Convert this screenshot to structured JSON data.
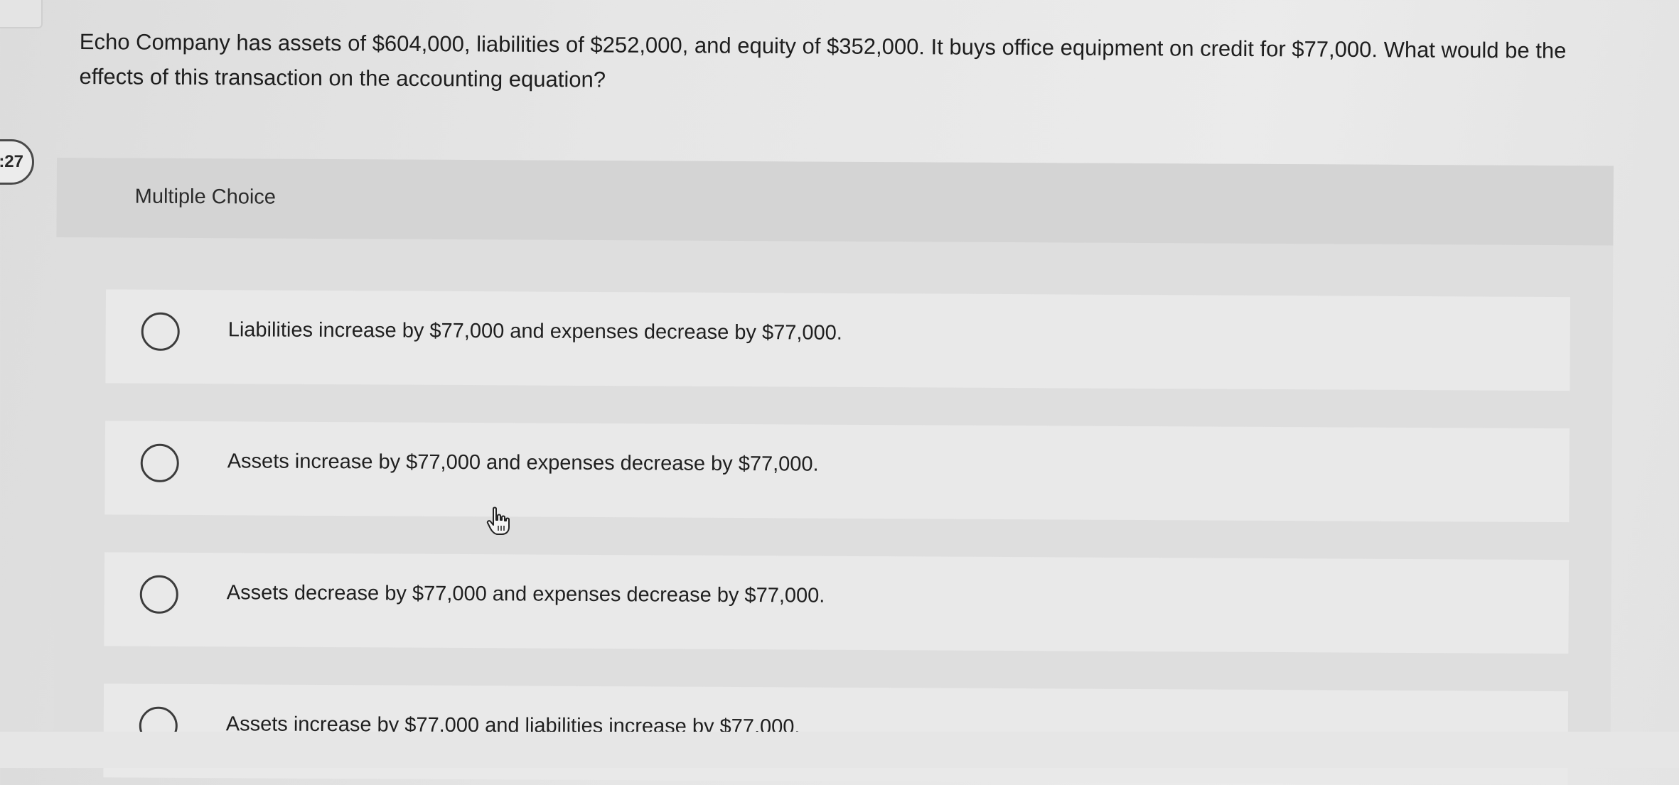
{
  "question": {
    "text": "Echo Company has assets of $604,000, liabilities of $252,000, and equity of $352,000. It buys office equipment on credit for $77,000. What would be the effects of this transaction on the accounting equation?"
  },
  "timer": {
    "text": ":27"
  },
  "multiple_choice": {
    "title": "Multiple Choice",
    "options": [
      {
        "label": "Liabilities increase by $77,000 and expenses decrease by $77,000."
      },
      {
        "label": "Assets increase by $77,000 and expenses decrease by $77,000."
      },
      {
        "label": "Assets decrease by $77,000 and expenses decrease by $77,000."
      },
      {
        "label": "Assets increase by $77,000 and liabilities increase by $77,000."
      }
    ]
  },
  "icons": {
    "radio": "radio-button-icon",
    "cursor": "hand-pointer-icon"
  }
}
